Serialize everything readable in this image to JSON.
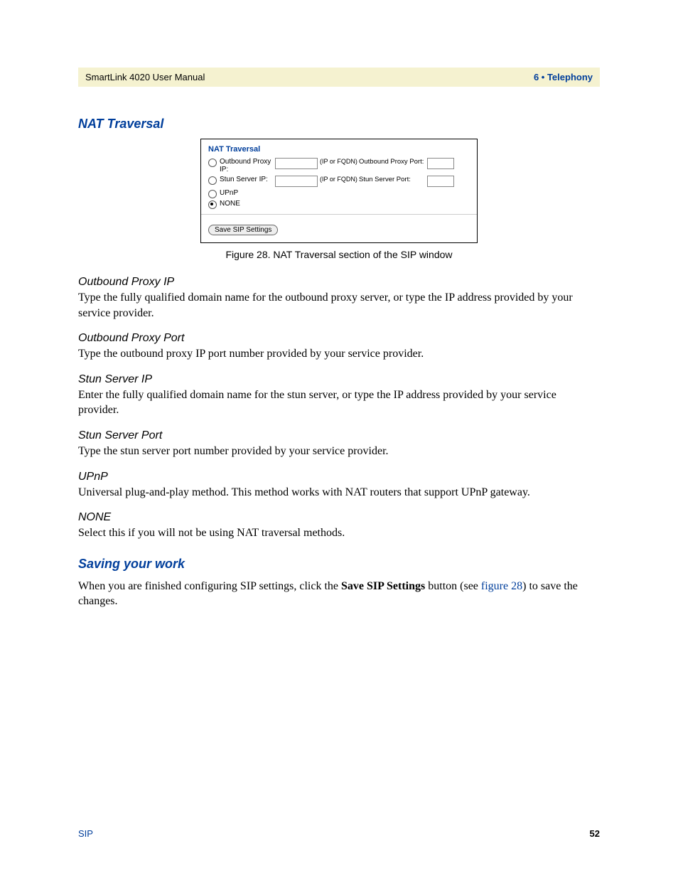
{
  "header": {
    "left": "SmartLink 4020 User Manual",
    "right": "6 • Telephony"
  },
  "section1": {
    "title": "NAT Traversal"
  },
  "figure": {
    "title": "NAT Traversal",
    "rows": {
      "outbound_label": "Outbound Proxy IP:",
      "ip_hint": "(IP or FQDN)",
      "outbound_port_label": "Outbound Proxy Port:",
      "stun_label": "Stun Server IP:",
      "stun_port_label": "Stun Server Port:",
      "upnp_label": "UPnP",
      "none_label": "NONE"
    },
    "button": "Save SIP Settings",
    "caption": "Figure 28. NAT Traversal section of the SIP window"
  },
  "subs": {
    "s1": {
      "h": "Outbound Proxy IP",
      "p": "Type the fully qualified domain name for the outbound proxy server, or type the IP address provided by your service provider."
    },
    "s2": {
      "h": "Outbound Proxy Port",
      "p": "Type the outbound proxy IP port number provided by your service provider."
    },
    "s3": {
      "h": "Stun Server IP",
      "p": "Enter the fully qualified domain name for the stun server, or type the IP address provided by your service provider."
    },
    "s4": {
      "h": "Stun Server Port",
      "p": "Type the stun server port number provided by your service provider."
    },
    "s5": {
      "h": "UPnP",
      "p": "Universal plug-and-play method. This method works with NAT routers that support UPnP gateway."
    },
    "s6": {
      "h": "NONE",
      "p": "Select this if you will not be using NAT traversal methods."
    }
  },
  "section2": {
    "title": "Saving your work",
    "p_before": "When you are finished configuring SIP settings, click the ",
    "p_bold": "Save SIP Settings",
    "p_mid": " button (see ",
    "p_link": "figure 28",
    "p_after": ") to save the changes."
  },
  "footer": {
    "left": "SIP",
    "right": "52"
  }
}
